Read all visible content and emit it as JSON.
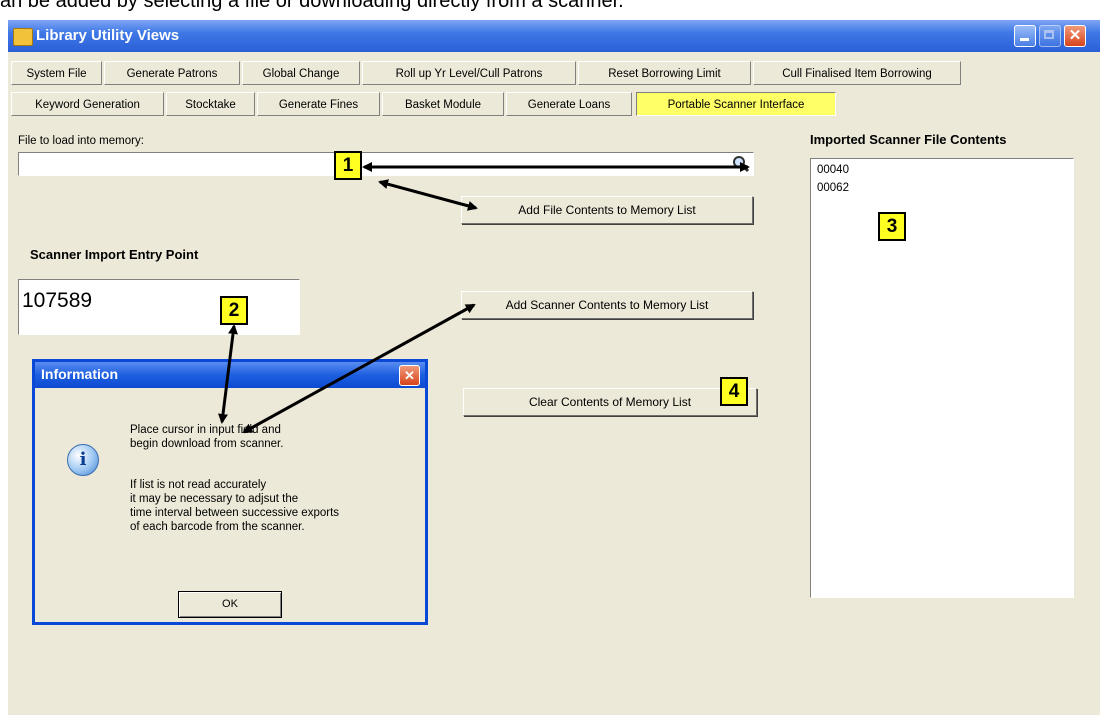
{
  "caption": "an be added by selecting a file or downloading directly from a scanner.",
  "window": {
    "title": "Library Utility Views",
    "icons": {
      "app": "book-icon",
      "minimize": "minimize-icon",
      "maximize": "maximize-icon",
      "close": "close-icon"
    }
  },
  "tabs_row1": [
    "System File",
    "Generate Patrons",
    "Global Change",
    "Roll up Yr Level/Cull Patrons",
    "Reset Borrowing Limit",
    "Cull Finalised Item Borrowing"
  ],
  "tabs_row2": [
    "Keyword Generation",
    "Stocktake",
    "Generate Fines",
    "Basket Module",
    "Generate Loans",
    "Portable Scanner Interface"
  ],
  "selected_tab": "Portable Scanner Interface",
  "file_section": {
    "label": "File to load into memory:",
    "value": "",
    "browse_icon": "magnifier-icon"
  },
  "buttons": {
    "add_file": "Add File Contents to Memory List",
    "add_scanner": "Add Scanner Contents to Memory List",
    "clear": "Clear Contents of Memory List"
  },
  "scanner": {
    "label": "Scanner Import Entry Point",
    "value": "107589"
  },
  "imported": {
    "label": "Imported Scanner File Contents",
    "items": [
      "00040",
      "00062"
    ]
  },
  "callouts": [
    "1",
    "2",
    "3",
    "4"
  ],
  "dialog": {
    "title": "Information",
    "icon": "info-icon",
    "line1": "Place cursor in input field and",
    "line2": "begin download from scanner.",
    "line3": "If list is not read accurately",
    "line4": "it may be necessary to adjsut the",
    "line5": "time interval between successive exports",
    "line6": "of each barcode from the scanner.",
    "ok": "OK"
  },
  "colors": {
    "highlight": "#ffff66",
    "callout": "#ffff22",
    "titlebar": "#2a5fd6",
    "window_bg": "#ece9d8"
  }
}
